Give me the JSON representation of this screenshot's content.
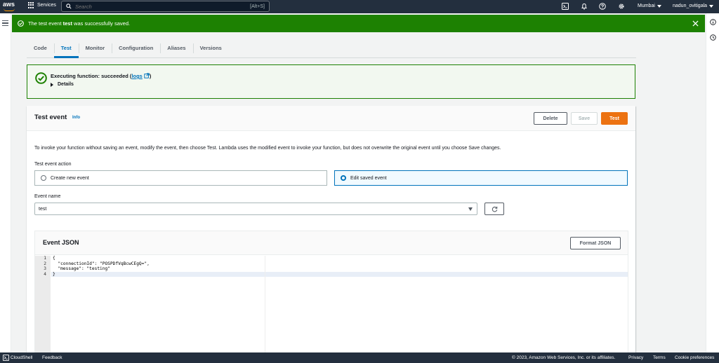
{
  "nav": {
    "logo_text": "aws",
    "services_label": "Services",
    "search_placeholder": "Search",
    "search_shortcut": "[Alt+S]",
    "region": "Mumbai",
    "user": "nadun_ovitigala",
    "icons": [
      "cloudshell-icon",
      "bell-icon",
      "help-icon",
      "gear-icon"
    ]
  },
  "flash": {
    "prefix": "The test event ",
    "event_name": "test",
    "suffix": " was successfully saved.",
    "color": "#1d8102"
  },
  "tabs": [
    {
      "label": "Code",
      "active": false
    },
    {
      "label": "Test",
      "active": true
    },
    {
      "label": "Monitor",
      "active": false
    },
    {
      "label": "Configuration",
      "active": false
    },
    {
      "label": "Aliases",
      "active": false
    },
    {
      "label": "Versions",
      "active": false
    }
  ],
  "result": {
    "title": "Executing function: succeeded (",
    "logs_link": "logs",
    "title_end": ")",
    "details_label": "Details"
  },
  "test_event": {
    "title": "Test event",
    "info_label": "Info",
    "delete_label": "Delete",
    "save_label": "Save",
    "test_label": "Test",
    "description": "To invoke your function without saving an event, modify the event, then choose Test. Lambda uses the modified event to invoke your function, but does not overwrite the original event until you choose Save changes.",
    "action_label": "Test event action",
    "option_create": "Create new event",
    "option_edit": "Edit saved event",
    "selected_option": "Edit saved event",
    "event_name_label": "Event name",
    "event_name_value": "test"
  },
  "event_json": {
    "title": "Event JSON",
    "format_label": "Format JSON",
    "line_numbers": [
      "1",
      "2",
      "3",
      "4"
    ],
    "lines": [
      "{",
      "  \"connectionId\": \"POSPDfVqBcwCEgQ=\",",
      "  \"message\": \"testing\"",
      "}"
    ]
  },
  "footer": {
    "cloudshell": "CloudShell",
    "feedback": "Feedback",
    "copyright": "© 2023, Amazon Web Services, Inc. or its affiliates.",
    "privacy": "Privacy",
    "terms": "Terms",
    "cookies": "Cookie preferences"
  }
}
